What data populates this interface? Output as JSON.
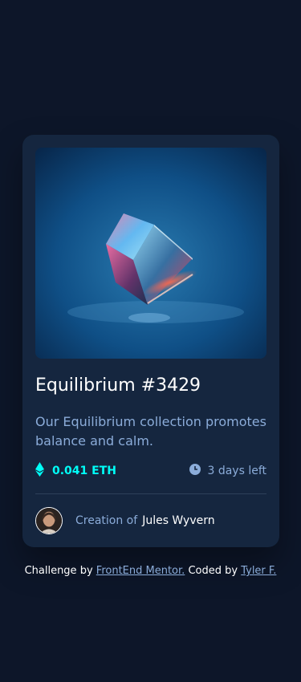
{
  "card": {
    "image_alt": "Equilibrium",
    "title": "Equilibrium #3429",
    "description": "Our Equilibrium collection promotes balance and calm.",
    "price": "0.041 ETH",
    "time_left": "3 days left",
    "creator_label": "Creation of",
    "creator_name": "Jules Wyvern"
  },
  "footer": {
    "prefix": "Challenge by",
    "link1": "FrontEnd Mentor.",
    "middle": "Coded by",
    "link2": "Tyler F."
  },
  "colors": {
    "page_bg": "#0d1629",
    "card_bg": "#15263f",
    "accent_cyan": "#00fff8",
    "soft_blue": "#8bacd9",
    "white": "#ffffff"
  },
  "icons": {
    "price": "ethereum-icon",
    "time": "clock-icon"
  }
}
